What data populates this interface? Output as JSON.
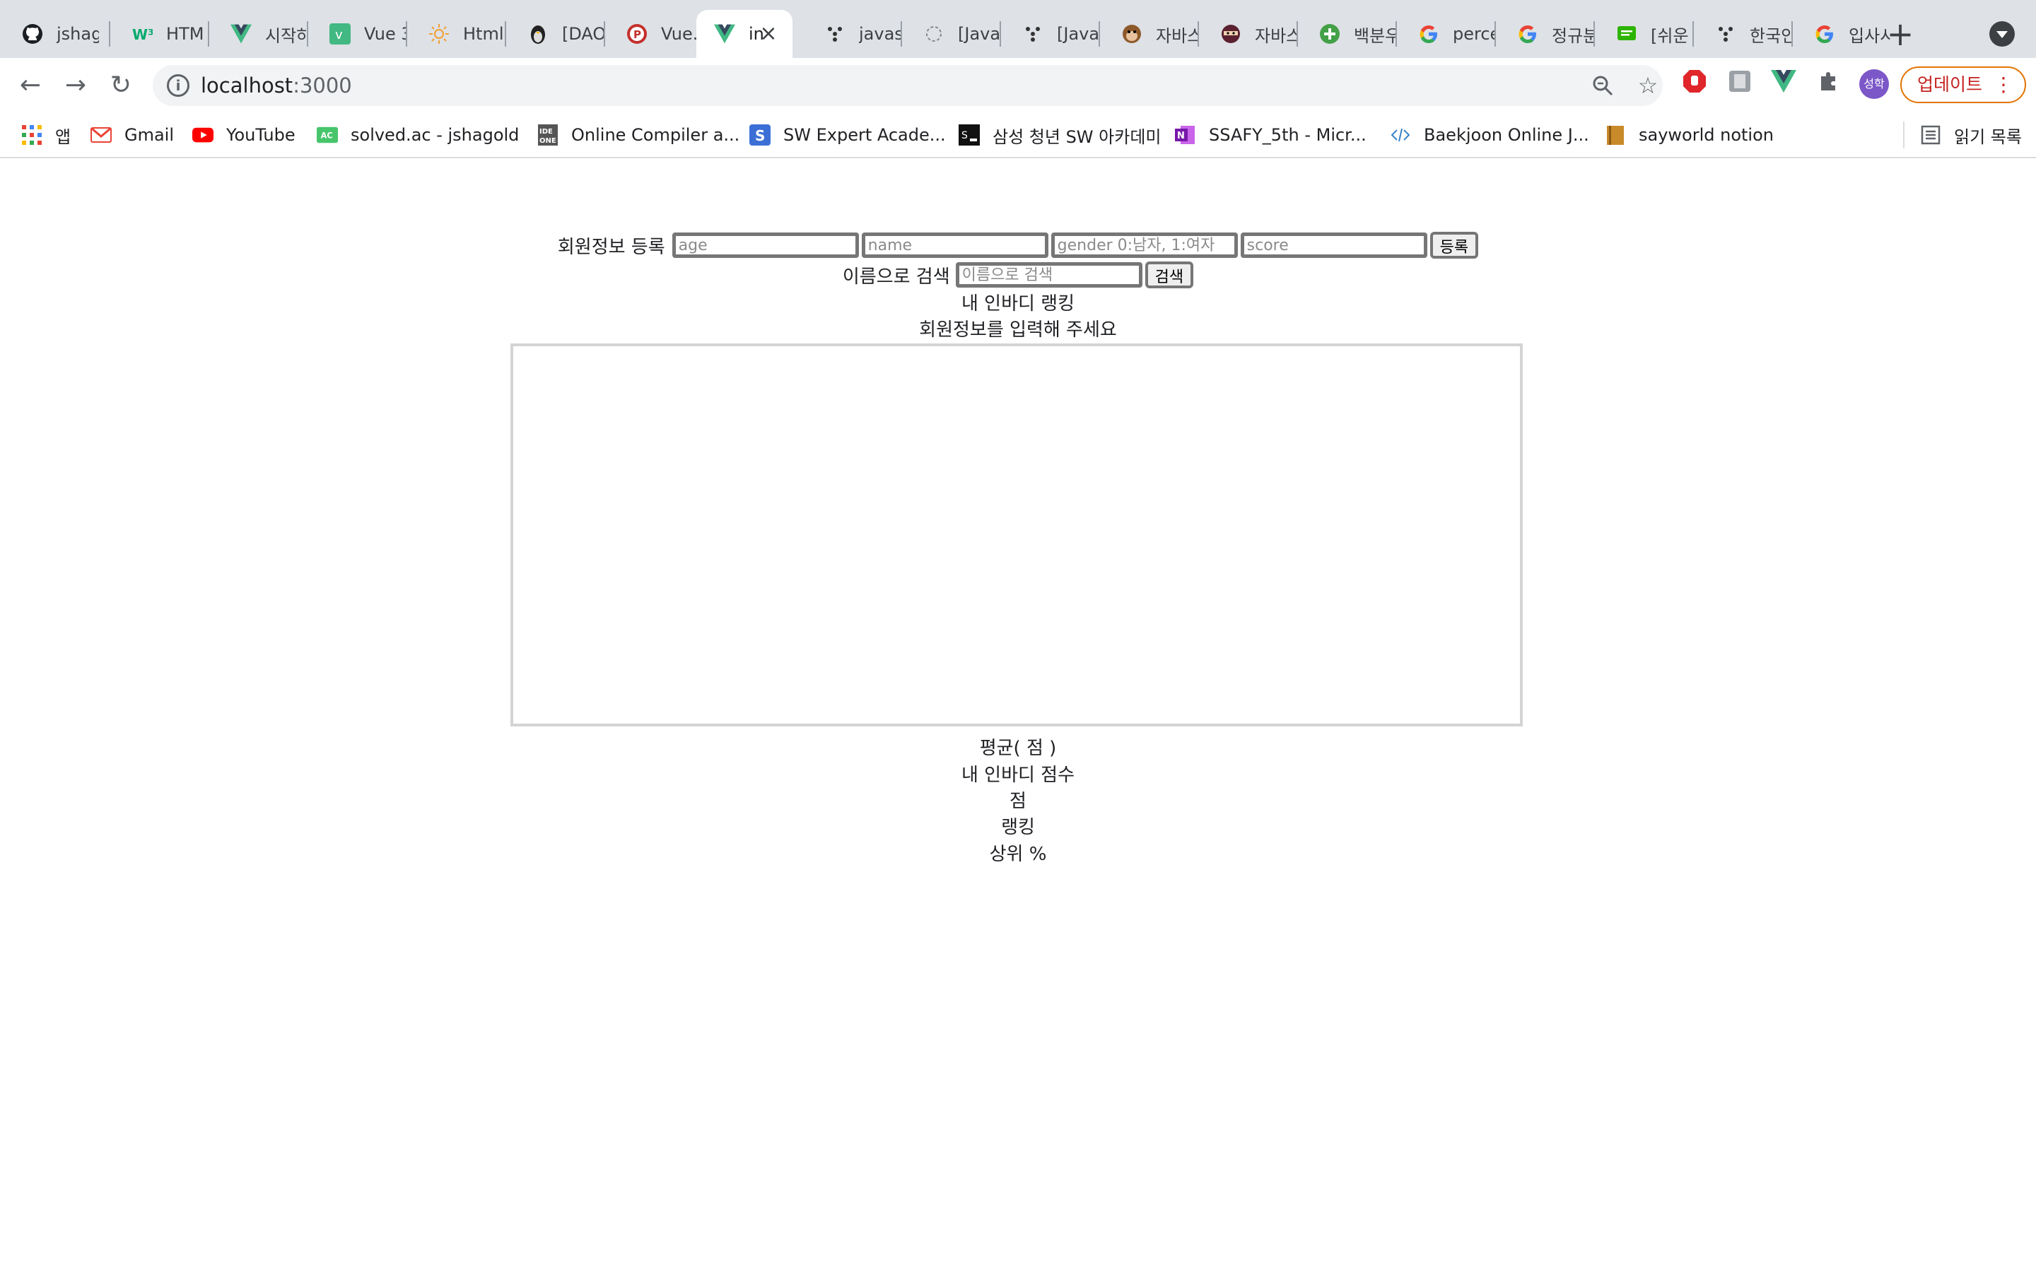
{
  "browser": {
    "tabs": [
      {
        "label": "jshag",
        "icon": "github-icon"
      },
      {
        "label": "HTM",
        "icon": "w3schools-icon"
      },
      {
        "label": "시작하",
        "icon": "vue-icon"
      },
      {
        "label": "Vue 3",
        "icon": "vue-square-icon"
      },
      {
        "label": "Html",
        "icon": "sun-icon"
      },
      {
        "label": "[DAO",
        "icon": "penguin-icon"
      },
      {
        "label": "Vue.j",
        "icon": "p-circle-icon"
      },
      {
        "label": "in",
        "icon": "vue-icon",
        "active": true
      },
      {
        "label": "javas",
        "icon": "dots-icon"
      },
      {
        "label": "[Java",
        "icon": "spinner-icon"
      },
      {
        "label": "[Java",
        "icon": "dots-icon"
      },
      {
        "label": "자바스",
        "icon": "monkey-icon"
      },
      {
        "label": "자바스",
        "icon": "ninja-icon"
      },
      {
        "label": "백분우",
        "icon": "plus-circle-icon"
      },
      {
        "label": "perce",
        "icon": "google-icon"
      },
      {
        "label": "정규분",
        "icon": "google-icon"
      },
      {
        "label": "[쉬운",
        "icon": "chat-icon"
      },
      {
        "label": "한국인",
        "icon": "dots-icon"
      },
      {
        "label": "입사시",
        "icon": "google-icon"
      }
    ],
    "url_host": "localhost",
    "url_port": ":3000",
    "profile_label": "성학",
    "update_label": "업데이트"
  },
  "bookmarks": {
    "apps": "앱",
    "items": [
      {
        "label": "Gmail",
        "icon": "gmail-icon"
      },
      {
        "label": "YouTube",
        "icon": "youtube-icon"
      },
      {
        "label": "solved.ac - jshagold",
        "icon": "solvedac-icon"
      },
      {
        "label": "Online Compiler a...",
        "icon": "ideone-icon"
      },
      {
        "label": "SW Expert Acade...",
        "icon": "swea-icon"
      },
      {
        "label": "삼성 청년 SW 아카데미",
        "icon": "ssafy-icon"
      },
      {
        "label": "SSAFY_5th - Micr...",
        "icon": "onenote-icon"
      },
      {
        "label": "Baekjoon Online J...",
        "icon": "code-icon"
      },
      {
        "label": "sayworld notion",
        "icon": "notion-icon"
      }
    ],
    "reading_list": "읽기 목록"
  },
  "page": {
    "register": {
      "label": "회원정보 등록",
      "age_placeholder": "age",
      "name_placeholder": "name",
      "gender_placeholder": "gender 0:남자, 1:여자",
      "score_placeholder": "score",
      "submit": "등록"
    },
    "search": {
      "label": "이름으로 검색",
      "placeholder": "이름으로 검색",
      "submit": "검색"
    },
    "ranking_title": "내 인바디 랭킹",
    "prompt": "회원정보를 입력해 주세요",
    "average": "평균( 점 )",
    "my_score_title": "내 인바디 점수",
    "points": "점",
    "ranking": "랭킹",
    "top_percent": "상위 %"
  }
}
